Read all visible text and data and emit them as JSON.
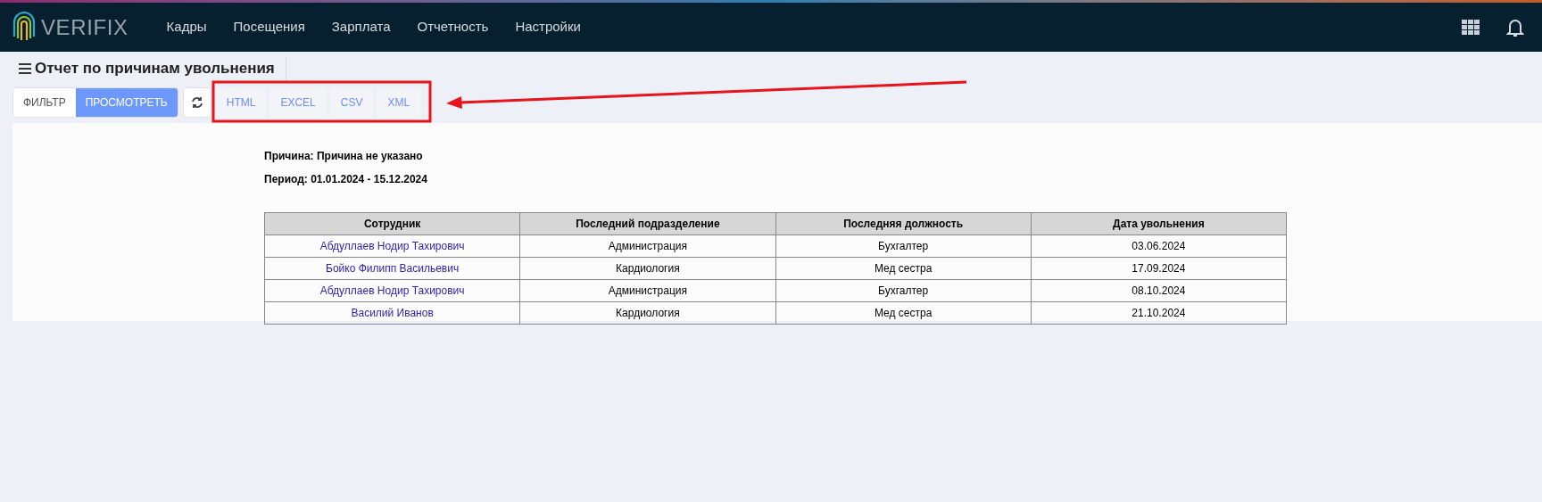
{
  "header": {
    "logo_text": "VERIFIX",
    "nav": [
      "Кадры",
      "Посещения",
      "Зарплата",
      "Отчетность",
      "Настройки"
    ]
  },
  "page_title": "Отчет по причинам увольнения",
  "view_toggle": [
    {
      "label": "ФИЛЬТР",
      "selected": false
    },
    {
      "label": "ПРОСМОТРЕТЬ",
      "selected": true
    }
  ],
  "export_buttons": [
    "HTML",
    "EXCEL",
    "CSV",
    "XML"
  ],
  "report": {
    "reason": "Причина: Причина не указано",
    "period": "Период: 01.01.2024 - 15.12.2024",
    "columns": [
      "Сотрудник",
      "Последний подразделение",
      "Последняя должность",
      "Дата увольнения"
    ],
    "rows": [
      [
        "Абдуллаев Нодир Тахирович",
        "Администрация",
        "Бухгалтер",
        "03.06.2024"
      ],
      [
        "Бойко Филипп Васильевич",
        "Кардиология",
        "Мед сестра",
        "17.09.2024"
      ],
      [
        "Абдуллаев Нодир Тахирович",
        "Администрация",
        "Бухгалтер",
        "08.10.2024"
      ],
      [
        "Василий Иванов",
        "Кардиология",
        "Мед сестра",
        "21.10.2024"
      ]
    ]
  }
}
